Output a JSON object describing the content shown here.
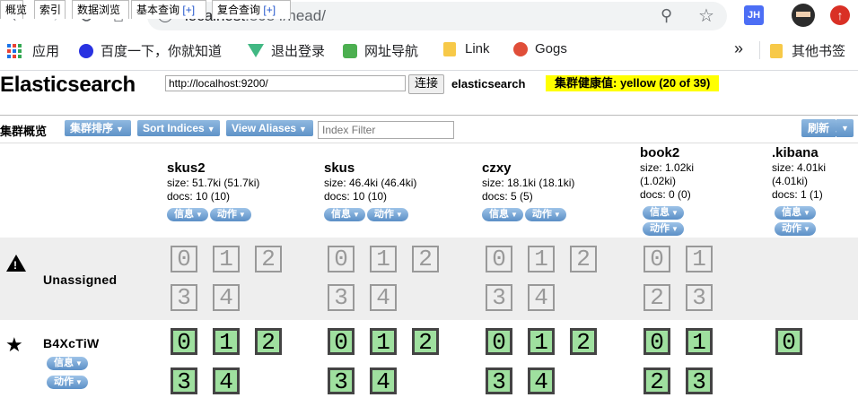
{
  "browser": {
    "url_host": "localhost",
    "url_rest": ":8084/head/",
    "ext_label": "JH",
    "bookmarks": [
      "应用",
      "百度一下，你就知道",
      "退出登录",
      "网址导航",
      "Link",
      "Gogs"
    ],
    "more": "»",
    "other_bookmarks": "其他书签"
  },
  "header": {
    "title": "Elasticsearch",
    "connect_url": "http://localhost:9200/",
    "connect_button": "连接",
    "cluster_name": "elasticsearch",
    "health": "集群健康值: yellow (20 of 39)",
    "info_button": "信息"
  },
  "tabs": [
    {
      "label": "概览"
    },
    {
      "label": "索引"
    },
    {
      "label": "数据浏览"
    },
    {
      "label": "基本查询",
      "plus": "[+]"
    },
    {
      "label": "复合查询",
      "plus": "[+]"
    }
  ],
  "toolbar": {
    "label": "集群概览",
    "sort_cluster": "集群排序",
    "sort_indices": "Sort Indices",
    "view_aliases": "View Aliases",
    "filter_placeholder": "Index Filter",
    "refresh": "刷新"
  },
  "pill_labels": {
    "info": "信息",
    "action": "动作"
  },
  "indices": [
    {
      "name": "skus2",
      "size": "size: 51.7ki (51.7ki)",
      "docs": "docs: 10 (10)"
    },
    {
      "name": "skus",
      "size": "size: 46.4ki (46.4ki)",
      "docs": "docs: 10 (10)"
    },
    {
      "name": "czxy",
      "size": "size: 18.1ki (18.1ki)",
      "docs": "docs: 5 (5)"
    },
    {
      "name": "book2",
      "size": "size: 1.02ki",
      "size2": "(1.02ki)",
      "docs": "docs: 0 (0)"
    },
    {
      "name": ".kibana",
      "size": "size: 4.01ki",
      "size2": "(4.01ki)",
      "docs": "docs: 1 (1)"
    }
  ],
  "rows": {
    "unassigned": {
      "label": "Unassigned"
    },
    "node": {
      "label": "B4XcTiW"
    }
  },
  "shards": {
    "unassigned": [
      [
        "0",
        "1",
        "2",
        "3",
        "4"
      ],
      [
        "0",
        "1",
        "2",
        "3",
        "4"
      ],
      [
        "0",
        "1",
        "2",
        "3",
        "4"
      ],
      [
        "0",
        "1",
        "2",
        "3"
      ],
      []
    ],
    "assigned": [
      [
        "0",
        "1",
        "2",
        "3",
        "4"
      ],
      [
        "0",
        "1",
        "2",
        "3",
        "4"
      ],
      [
        "0",
        "1",
        "2",
        "3",
        "4"
      ],
      [
        "0",
        "1",
        "2",
        "3"
      ],
      [
        "0"
      ]
    ]
  }
}
